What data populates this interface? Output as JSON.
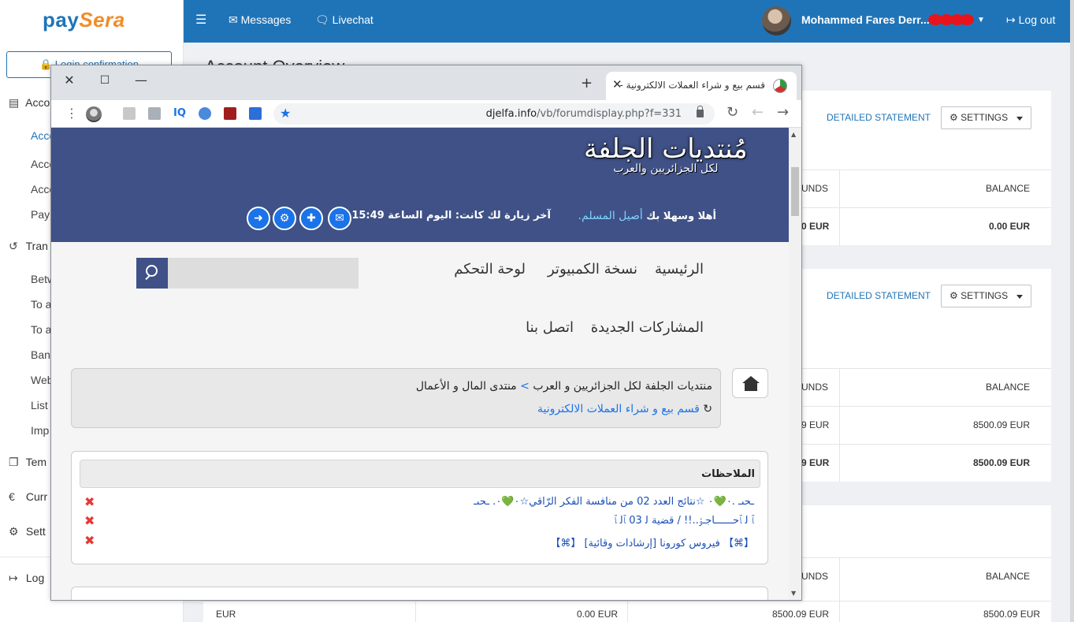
{
  "paysera": {
    "logo": {
      "part1": "pay",
      "part2": "Sera"
    },
    "login_button": "Login confirmation",
    "sidebar": {
      "sections": [
        {
          "label": "Acco",
          "icon": "accounts-icon"
        },
        {
          "label": "Tran",
          "icon": "transfers-icon"
        },
        {
          "label": "Tem",
          "icon": "templates-icon"
        },
        {
          "label": "Curr",
          "icon": "currency-icon"
        },
        {
          "label": "Sett",
          "icon": "settings-icon"
        },
        {
          "label": "Log",
          "icon": "logout-icon"
        }
      ],
      "account_items": [
        "Acco",
        "Acco",
        "Acco",
        "Pay"
      ],
      "transfer_items": [
        "Betw",
        "To a",
        "To a",
        "Ban",
        "Web",
        "List",
        "Imp"
      ]
    },
    "topbar": {
      "messages": "Messages",
      "livechat": "Livechat",
      "user_name": "Mohammed Fares Derr...",
      "logout": "Log out"
    },
    "page_title": "Account Overview",
    "cards": [
      {
        "detailed_statement": "DETAILED STATEMENT",
        "settings": "SETTINGS",
        "col_funds": "UNDS",
        "col_balance": "BALANCE",
        "row1_funds": "0 EUR",
        "row1_balance": "0.00 EUR"
      },
      {
        "detailed_statement": "DETAILED STATEMENT",
        "settings": "SETTINGS",
        "col_funds": "UNDS",
        "col_balance": "BALANCE",
        "row1_funds": "9 EUR",
        "row1_balance": "8500.09 EUR",
        "row2_funds": "9 EUR",
        "row2_balance": "8500.09 EUR"
      },
      {
        "col_funds": "UNDS",
        "col_balance": "BALANCE"
      }
    ],
    "bottom_row": [
      "EUR",
      "0.00 EUR",
      "8500.09 EUR",
      "8500.09 EUR"
    ]
  },
  "browser": {
    "tab_title": "قسم بيع و شراء العملات الالكترونية -",
    "url_host": "djelfa.info",
    "url_path": "/vb/forumdisplay.php?f=331",
    "extensions": [
      "avatar-ext-icon",
      "ext-1-icon",
      "ext-2-icon",
      "iq-ext-icon",
      "ext-4-icon",
      "ext-5-icon",
      "ext-6-icon"
    ],
    "extension_iq_label": "IQ"
  },
  "forum": {
    "logo_main": "مُنتديات الجلفة",
    "logo_sub": "لكل الجزائريين والعرب",
    "welcome_prefix": "أهلا وسهلا بك",
    "username": "أصيل المسلم.",
    "last_visit": "آخر زيارة لك كانت: اليوم الساعة 15:49",
    "nav": {
      "home": "الرئيسية",
      "desktop": "نسخة الكمبيوتر",
      "control_panel": "لوحة التحكم",
      "new_posts": "المشاركات الجديدة",
      "contact": "اتصل بنا"
    },
    "breadcrumb": {
      "root": "منتديات الجلفة لكل الجزائريين و العرب",
      "separator": ">",
      "parent": "منتدى المال و الأعمال",
      "current": "قسم بيع و شراء العملات الالكترونية"
    },
    "notes": {
      "title": "الملاحظات",
      "items": [
        "ـحىـ .٠💚٠ ☆نتائج العدد 02 من منافسة الفكر الرّاقي☆٠💚٠. ـحىـ",
        "ﭑ ﻟ ﭑﺣــــــاﺟـﯢ..!! / قضية ﻟ 03 ﭑﻟ ﭑ",
        "【⌘】 فيروس كورونا [إرشادات وقائية] 【⌘】"
      ]
    }
  }
}
